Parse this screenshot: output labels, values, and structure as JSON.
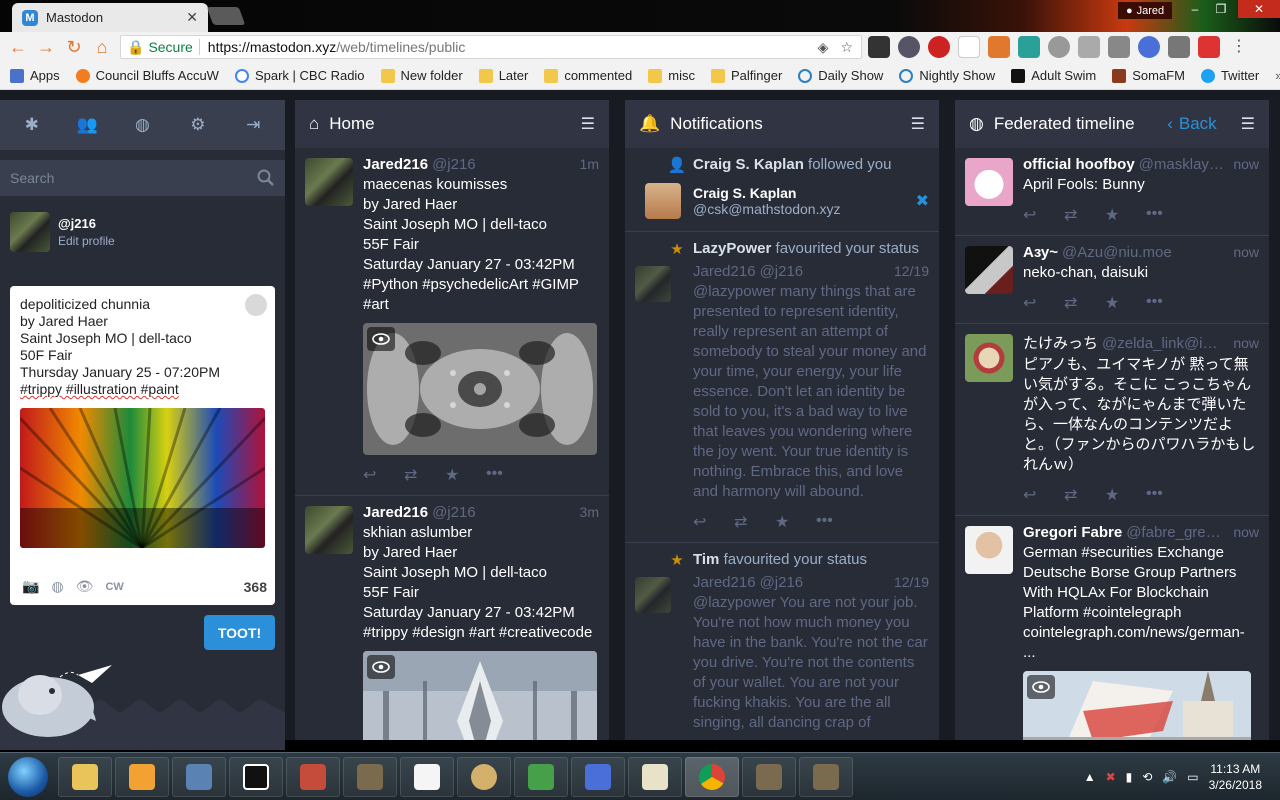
{
  "browser": {
    "tab_title": "Mastodon",
    "tab_favicon": "M",
    "profile_name": "Jared",
    "secure_label": "Secure",
    "url_scheme_host": "https://mastodon.xyz",
    "url_path": "/web/timelines/public"
  },
  "bookmarks": [
    {
      "label": "Apps",
      "icon": "apps-grid-icon"
    },
    {
      "label": "Council Bluffs AccuW",
      "icon": "weather-sun-icon"
    },
    {
      "label": "Spark | CBC Radio",
      "icon": "google-icon"
    },
    {
      "label": "New folder",
      "icon": "folder-icon"
    },
    {
      "label": "Later",
      "icon": "folder-icon"
    },
    {
      "label": "commented",
      "icon": "folder-icon"
    },
    {
      "label": "misc",
      "icon": "folder-icon"
    },
    {
      "label": "Palfinger",
      "icon": "folder-icon"
    },
    {
      "label": "Daily Show",
      "icon": "cc-icon"
    },
    {
      "label": "Nightly Show",
      "icon": "cc-icon"
    },
    {
      "label": "Adult Swim",
      "icon": "adult-swim-icon"
    },
    {
      "label": "SomaFM",
      "icon": "somafm-icon"
    },
    {
      "label": "Twitter",
      "icon": "twitter-bird-icon"
    }
  ],
  "compose": {
    "search_placeholder": "Search",
    "account": "@j216",
    "edit_profile": "Edit profile",
    "draft": "depoliticized chunnia\nby Jared Haer\nSaint Joseph MO | dell-taco\n50F Fair\nThursday January 25 - 07:20PM",
    "draft_tags": "#trippy #illustration #paint",
    "cw_label": "CW",
    "char_count": "368",
    "toot_button": "TOOT!"
  },
  "home": {
    "title": "Home",
    "statuses": [
      {
        "name": "Jared216",
        "acct": "@j216",
        "time": "1m",
        "body": "maecenas koumisses\nby Jared Haer\nSaint Joseph MO | dell-taco\n55F Fair\nSaturday January 27 - 03:42PM\n#Python #psychedelicArt #GIMP\n#art"
      },
      {
        "name": "Jared216",
        "acct": "@j216",
        "time": "3m",
        "body": "skhian aslumber\nby Jared Haer\nSaint Joseph MO | dell-taco\n55F Fair\nSaturday January 27 - 03:42PM\n#trippy #design #art #creativecode"
      }
    ]
  },
  "notifications": {
    "title": "Notifications",
    "items": [
      {
        "who": "Craig S. Kaplan",
        "action": " followed you",
        "display_name": "Craig S. Kaplan",
        "acct": "@csk@mathstodon.xyz"
      },
      {
        "who": "LazyPower",
        "action": " favourited your status",
        "name": "Jared216",
        "acct": "@j216",
        "time": "12/19",
        "body": "@lazypower many things that are presented to represent identity, really represent an attempt of somebody to steal your money and your time, your energy, your life essence. Don't let an identity be sold to you, it's a bad way to live that leaves you wondering where the joy went. Your true identity is nothing. Embrace this, and love and harmony will abound."
      },
      {
        "who": "Tim",
        "action": " favourited your status",
        "name": "Jared216",
        "acct": "@j216",
        "time": "12/19",
        "body": "@lazypower You are not your job. You're not how much money you have in the bank. You're not the car you drive. You're not the contents of your wallet. You are not your fucking khakis. You are the all singing, all dancing crap of"
      }
    ]
  },
  "federated": {
    "title": "Federated timeline",
    "back_label": "Back",
    "statuses": [
      {
        "name": "official hoofboy",
        "acct": "@masklayer...",
        "time": "now",
        "body": "April Fools: Bunny"
      },
      {
        "name": "Азу~",
        "acct": "@Azu@niu.moe",
        "time": "now",
        "body": "neko-chan, daisuki"
      },
      {
        "name": "たけみっち",
        "acct": "@zelda_link@ima...",
        "time": "now",
        "body": "ピアノも、ユイマキノが 黙って無い気がする。そこに こっこちゃんが入って、ながにゃんまで弾いたら、一体なんのコンテンツだよと。（ファンからのパワハラかもしれんｗ）"
      },
      {
        "name": "Gregori Fabre",
        "acct": "@fabre_gregori...",
        "time": "now",
        "body": "German #securities Exchange Deutsche Borse Group Partners With HQLAx For Blockchain Platform #cointelegraph cointelegraph.com/news/german-\n..."
      }
    ]
  },
  "taskbar": {
    "time": "11:13 AM",
    "date": "3/26/2018"
  },
  "colors": {
    "accent": "#2b90d9",
    "column_bg": "#282c37",
    "header_bg": "#313543",
    "muted_text": "#606984",
    "fav_star": "#ca8f04"
  }
}
